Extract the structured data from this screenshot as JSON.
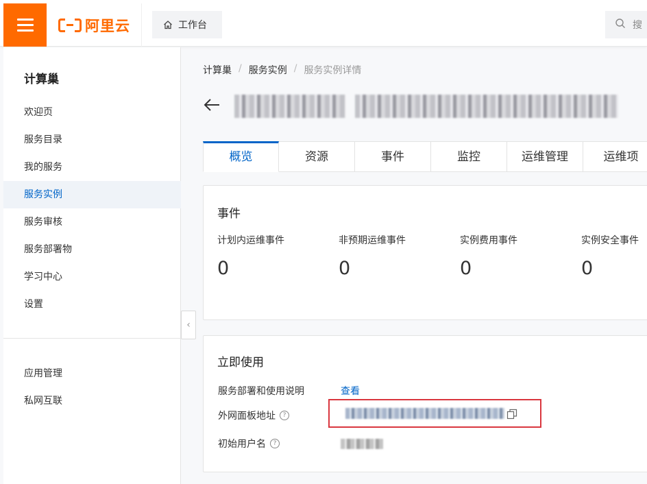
{
  "topbar": {
    "logo_text": "阿里云",
    "workbench_label": "工作台",
    "search_placeholder": "搜"
  },
  "sidebar": {
    "title": "计算巢",
    "items": [
      {
        "label": "欢迎页"
      },
      {
        "label": "服务目录"
      },
      {
        "label": "我的服务"
      },
      {
        "label": "服务实例"
      },
      {
        "label": "服务审核"
      },
      {
        "label": "服务部署物"
      },
      {
        "label": "学习中心"
      },
      {
        "label": "设置"
      }
    ],
    "items2": [
      {
        "label": "应用管理"
      },
      {
        "label": "私网互联"
      }
    ],
    "collapse_glyph": "‹"
  },
  "breadcrumb": {
    "items": [
      "计算巢",
      "服务实例",
      "服务实例详情"
    ],
    "separator": "/"
  },
  "tabs": [
    "概览",
    "资源",
    "事件",
    "监控",
    "运维管理",
    "运维项"
  ],
  "events_card": {
    "title": "事件",
    "items": [
      {
        "label": "计划内运维事件",
        "value": "0"
      },
      {
        "label": "非预期运维事件",
        "value": "0"
      },
      {
        "label": "实例费用事件",
        "value": "0"
      },
      {
        "label": "实例安全事件",
        "value": "0"
      }
    ]
  },
  "use_card": {
    "title": "立即使用",
    "rows": {
      "deploy_label": "服务部署和使用说明",
      "deploy_link": "查看",
      "url_label": "外网面板地址",
      "username_label": "初始用户名"
    },
    "help_glyph": "?"
  },
  "colors": {
    "brand": "#ff6a00",
    "link": "#0064c8",
    "highlight_border": "#d9363e"
  }
}
